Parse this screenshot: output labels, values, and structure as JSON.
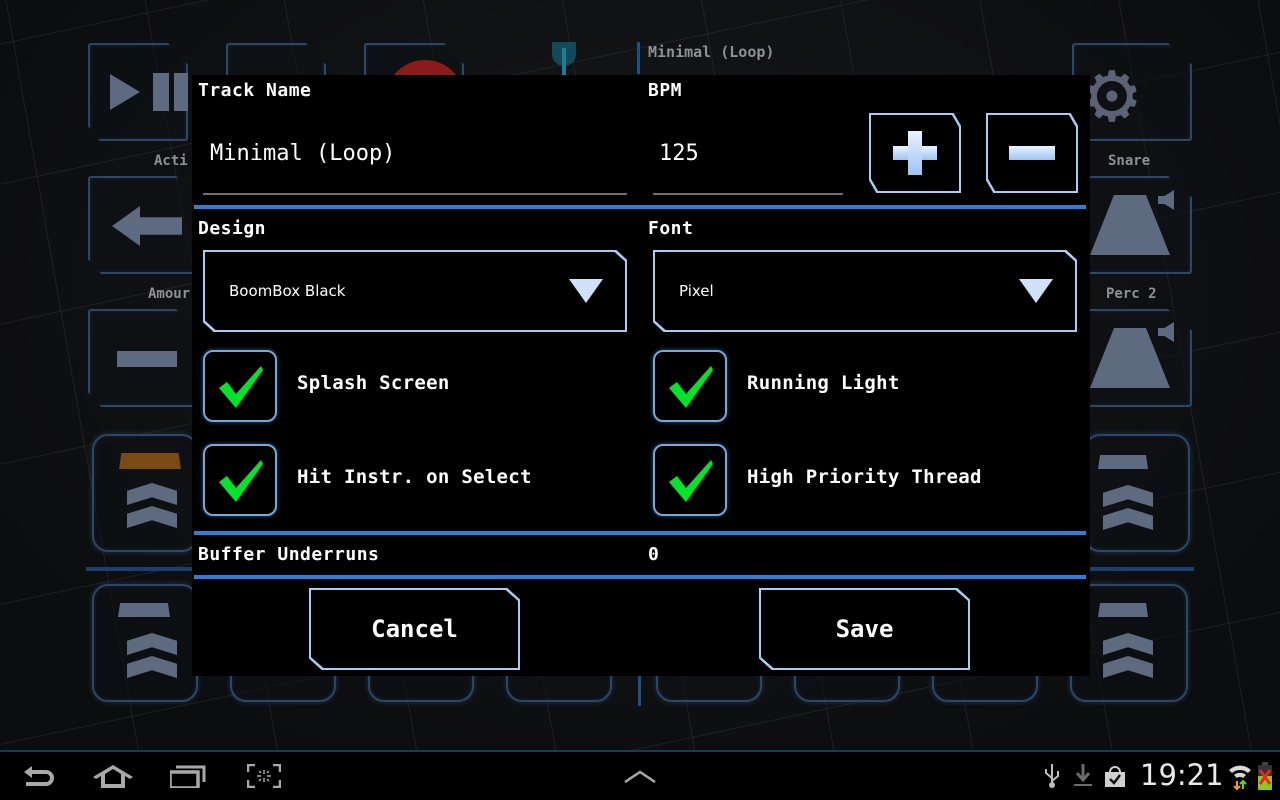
{
  "background_app": {
    "track_title": "Minimal (Loop)",
    "labels": {
      "action": "Acti",
      "amount": "Amour",
      "snare": "Snare",
      "perc2": "Perc 2"
    }
  },
  "dialog": {
    "track_name": {
      "label": "Track Name",
      "value": "Minimal (Loop)"
    },
    "bpm": {
      "label": "BPM",
      "value": "125",
      "increment_icon": "plus-icon",
      "decrement_icon": "minus-icon"
    },
    "design": {
      "label": "Design",
      "selected": "BoomBox Black"
    },
    "font": {
      "label": "Font",
      "selected": "Pixel"
    },
    "checkboxes": [
      {
        "label": "Splash Screen",
        "checked": true
      },
      {
        "label": "Running Light",
        "checked": true
      },
      {
        "label": "Hit Instr. on Select",
        "checked": true
      },
      {
        "label": "High Priority Thread",
        "checked": true
      }
    ],
    "buffer_underruns": {
      "label": "Buffer Underruns",
      "value": "0"
    },
    "buttons": {
      "cancel": "Cancel",
      "save": "Save"
    },
    "colors": {
      "accent": "#2f7ddb",
      "check": "#00e52a",
      "border": "#7aa7d8"
    }
  },
  "navbar": {
    "icons": [
      "back-icon",
      "home-icon",
      "recent-apps-icon",
      "screenshot-icon",
      "menu-up-icon"
    ],
    "status_icons": [
      "usb-icon",
      "download-icon",
      "store-icon",
      "wifi-icon",
      "battery-icon"
    ],
    "clock": "19:21"
  }
}
